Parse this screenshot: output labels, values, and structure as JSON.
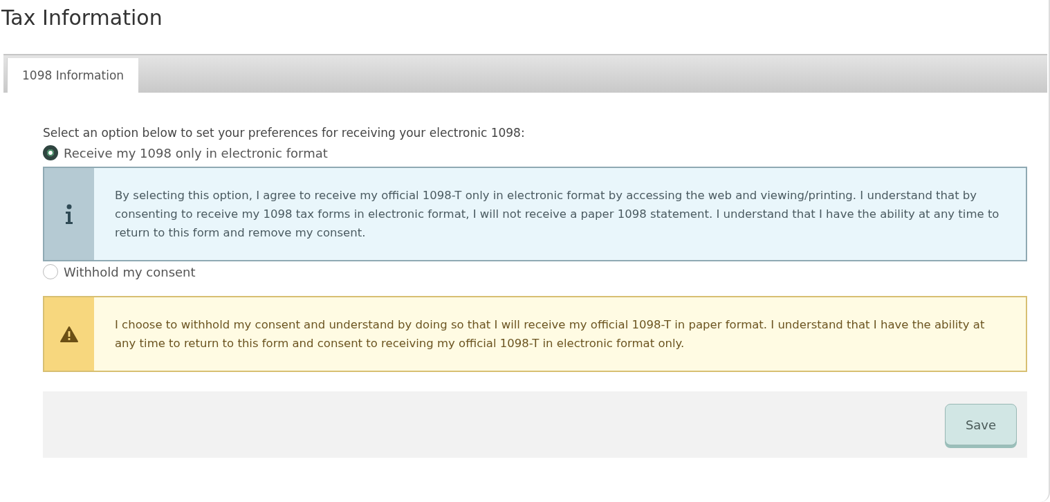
{
  "page": {
    "title": "Tax Information"
  },
  "tabs": [
    {
      "label": "1098 Information",
      "selected": true
    }
  ],
  "prompt": "Select an option below to set your preferences for receiving your electronic 1098:",
  "options": [
    {
      "label": "Receive my 1098 only in electronic format",
      "selected": true,
      "notice": {
        "kind": "info",
        "text": "By selecting this option, I agree to receive my official 1098-T only in electronic format by accessing the web and viewing/printing. I understand that by consenting to receive my 1098 tax forms in electronic format, I will not receive a paper 1098 statement. I understand that I have the ability at any time to return to this form and remove my consent."
      }
    },
    {
      "label": "Withhold my consent",
      "selected": false,
      "notice": {
        "kind": "warning",
        "text": "I choose to withhold my consent and understand by doing so that I will receive my official 1098-T in paper format. I understand that I have the ability at any time to return to this form and consent to receiving my official 1098-T in electronic format only."
      }
    }
  ],
  "buttons": [
    {
      "label": "Save"
    }
  ]
}
